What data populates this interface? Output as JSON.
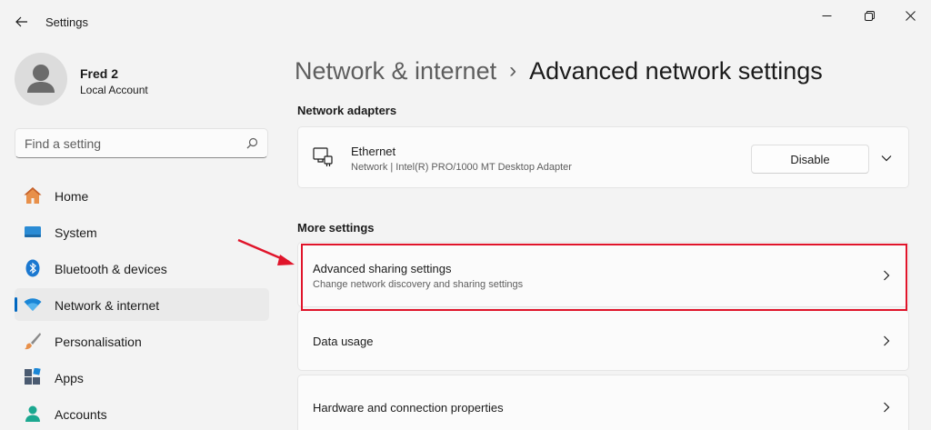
{
  "window": {
    "title": "Settings"
  },
  "profile": {
    "name": "Fred 2",
    "account_type": "Local Account"
  },
  "search": {
    "placeholder": "Find a setting",
    "value": ""
  },
  "nav": {
    "items": [
      {
        "label": "Home",
        "icon": "home-icon"
      },
      {
        "label": "System",
        "icon": "system-icon"
      },
      {
        "label": "Bluetooth & devices",
        "icon": "bluetooth-icon"
      },
      {
        "label": "Network & internet",
        "icon": "wifi-icon",
        "selected": true
      },
      {
        "label": "Personalisation",
        "icon": "brush-icon"
      },
      {
        "label": "Apps",
        "icon": "apps-icon"
      },
      {
        "label": "Accounts",
        "icon": "accounts-icon"
      }
    ]
  },
  "breadcrumb": {
    "parent": "Network & internet",
    "separator": "›",
    "current": "Advanced network settings"
  },
  "sections": {
    "adapters_title": "Network adapters",
    "more_title": "More settings"
  },
  "adapter": {
    "name": "Ethernet",
    "description": "Network | Intel(R) PRO/1000 MT Desktop Adapter",
    "button_label": "Disable"
  },
  "more_settings": [
    {
      "title": "Advanced sharing settings",
      "subtitle": "Change network discovery and sharing settings",
      "highlighted": true
    },
    {
      "title": "Data usage",
      "subtitle": ""
    },
    {
      "title": "Hardware and connection properties",
      "subtitle": ""
    }
  ],
  "colors": {
    "accent": "#0067c0",
    "highlight": "#e0142a"
  }
}
